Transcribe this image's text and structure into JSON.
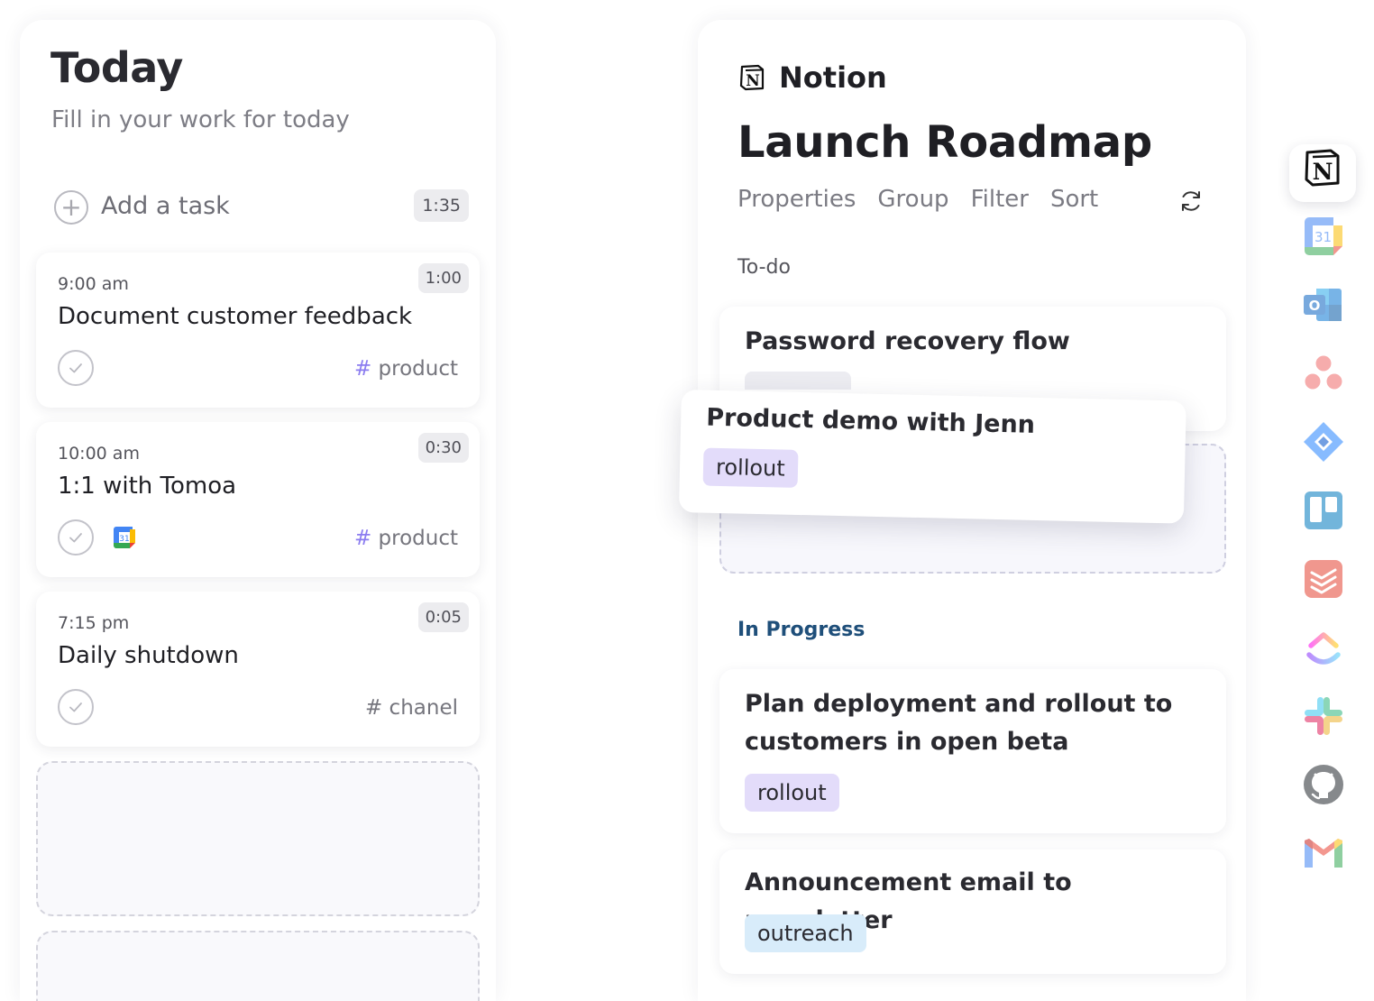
{
  "today": {
    "title": "Today",
    "subtitle": "Fill in your work for today",
    "add_task_label": "Add a task",
    "total_time": "1:35",
    "tasks": [
      {
        "time": "9:00 am",
        "title": "Document customer feedback",
        "duration": "1:00",
        "tag_hash": "#",
        "tag": " product"
      },
      {
        "time": "10:00 am",
        "title": "1:1 with Tomoa",
        "duration": "0:30",
        "tag_hash": "#",
        "tag": " product",
        "calendar_date": "31"
      },
      {
        "time": "7:15 pm",
        "title": "Daily shutdown",
        "duration": "0:05",
        "tag_hash": "#",
        "tag": " chanel"
      }
    ]
  },
  "notion": {
    "app_name": "Notion",
    "logo_letter": "N",
    "board_title": "Launch Roadmap",
    "toolbar": [
      "Properties",
      "Group",
      "Filter",
      "Sort"
    ],
    "groups": {
      "todo": {
        "label": "To-do",
        "cards": [
          {
            "title": "Password recovery flow"
          }
        ]
      },
      "in_progress": {
        "label": "In Progress",
        "cards": [
          {
            "title_line1": "Plan deployment and rollout to",
            "title_line2": "customers in open beta",
            "tag": "rollout"
          },
          {
            "title": "Announcement email to newsletter",
            "tag": "outreach"
          }
        ]
      }
    },
    "dragging_card": {
      "title": "Product demo with Jenn",
      "tag": "rollout"
    }
  },
  "app_rail": {
    "items": [
      "notion-icon",
      "google-calendar-icon",
      "outlook-icon",
      "asana-icon",
      "jira-icon",
      "trello-icon",
      "todoist-icon",
      "clickup-icon",
      "slack-icon",
      "github-icon",
      "gmail-icon"
    ],
    "active": "notion-icon",
    "calendar_date": "31",
    "outlook_letter": "O"
  },
  "colors": {
    "tag_hash": "#8b7cf0",
    "pill_rollout": "#e3dcfa",
    "pill_outreach": "#d8ecfa",
    "in_progress_label": "#1f4f7a"
  }
}
